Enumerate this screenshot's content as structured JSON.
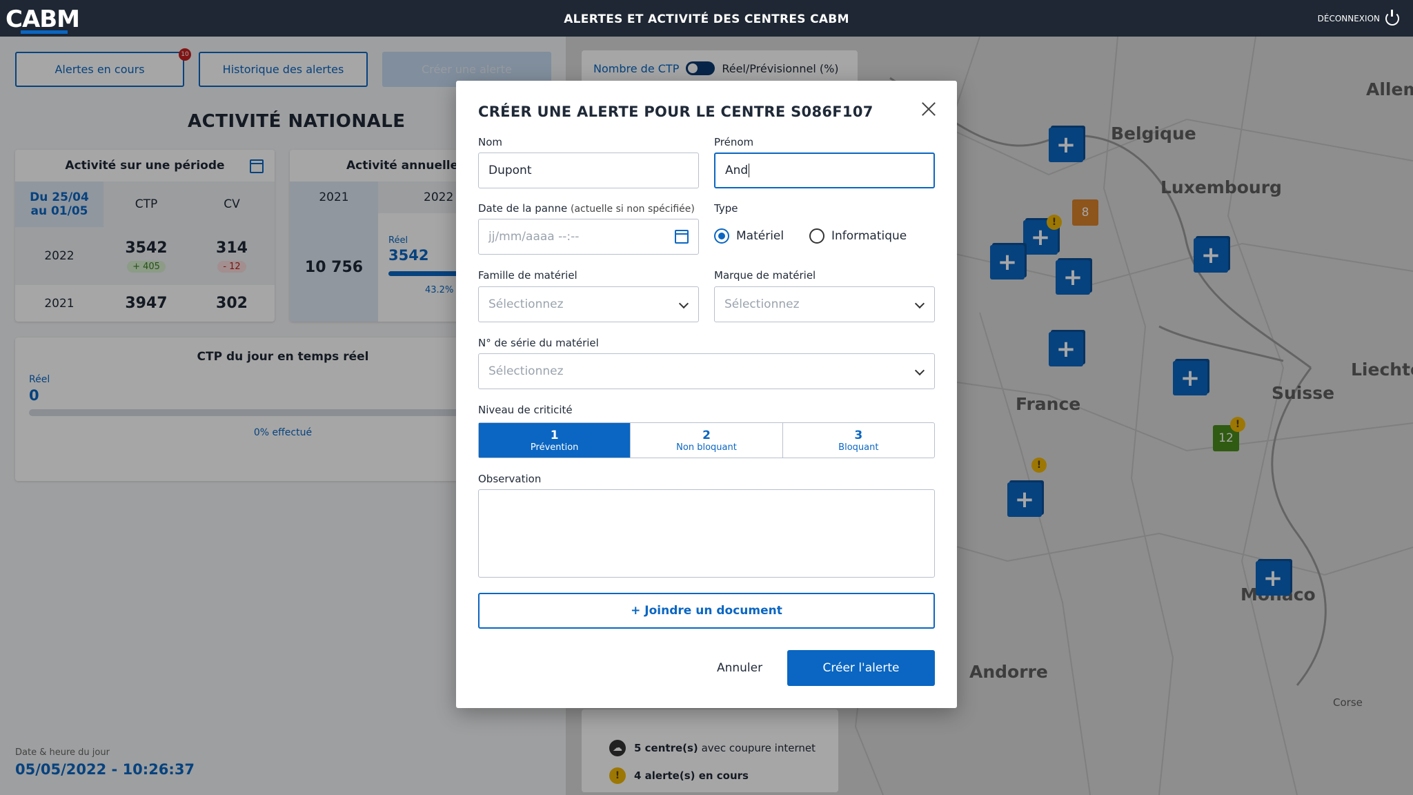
{
  "header": {
    "logo": "CABM",
    "title": "ALERTES ET ACTIVITÉ DES CENTRES CABM",
    "logout_label": "DÉCONNEXION"
  },
  "left": {
    "tabs": {
      "current_alerts": "Alertes en cours",
      "current_alerts_badge": "10",
      "history": "Historique des alertes",
      "create": "Créer une alerte"
    },
    "national_title": "ACTIVITÉ NATIONALE",
    "period_card": {
      "title": "Activité sur une période",
      "range": "Du 25/04 au 01/05",
      "col_ctp": "CTP",
      "col_cv": "CV",
      "rows": [
        {
          "year": "2022",
          "ctp": "3542",
          "ctp_delta": "+ 405",
          "cv": "314",
          "cv_delta": "- 12"
        },
        {
          "year": "2021",
          "ctp": "3947",
          "cv": "302"
        }
      ]
    },
    "annual_card": {
      "title": "Activité annuelle d",
      "col_2021": "2021",
      "col_2022": "2022 -",
      "value_2021": "10 756",
      "real_label": "Réel",
      "real_value": "3542",
      "progress_pct": "43.2%",
      "progress_fraction": 0.432
    },
    "realtime_card": {
      "title": "CTP du jour en temps réel",
      "real_label": "Réel",
      "value": "0",
      "progress_text": "0% effectué"
    },
    "datetime_label": "Date & heure du jour",
    "datetime_value": "05/05/2022 - 10:26:37"
  },
  "map": {
    "toggle_left": "Nombre de CTP",
    "toggle_right": "Réel/Prévisionnel (%)",
    "labels": [
      "Allem",
      "Belgique",
      "Luxembourg",
      "Liechte",
      "Suisse",
      "France",
      "Monaco",
      "Andorre",
      "Corse"
    ],
    "counts": [
      "8",
      "12"
    ],
    "legend": {
      "internet": "5 centre(s) avec coupure internet",
      "internet_bold": "5 centre(s)",
      "internet_rest": "avec coupure internet",
      "alerts": "4 alerte(s) en cours"
    }
  },
  "modal": {
    "title": "CRÉER UNE ALERTE POUR LE CENTRE S086F107",
    "nom_label": "Nom",
    "nom_value": "Dupont",
    "prenom_label": "Prénom",
    "prenom_value": "And",
    "date_label": "Date de la panne",
    "date_hint": "(actuelle si non spécifiée)",
    "date_placeholder": "jj/mm/aaaa --:--",
    "type_label": "Type",
    "type_options": [
      "Matériel",
      "Informatique"
    ],
    "type_selected": "Matériel",
    "famille_label": "Famille de matériel",
    "famille_placeholder": "Sélectionnez",
    "marque_label": "Marque de matériel",
    "marque_placeholder": "Sélectionnez",
    "serie_label": "N° de série du matériel",
    "serie_placeholder": "Sélectionnez",
    "criticite_label": "Niveau de criticité",
    "criticite": [
      {
        "num": "1",
        "text": "Prévention"
      },
      {
        "num": "2",
        "text": "Non bloquant"
      },
      {
        "num": "3",
        "text": "Bloquant"
      }
    ],
    "criticite_selected": "1",
    "observation_label": "Observation",
    "join_label": "+ Joindre un document",
    "cancel_label": "Annuler",
    "submit_label": "Créer l'alerte"
  },
  "colors": {
    "primary": "#0a66c2",
    "header_bg": "#1e2733",
    "warning": "#f2b705",
    "count_orange": "#d9822b",
    "count_green": "#4a8c1c"
  }
}
